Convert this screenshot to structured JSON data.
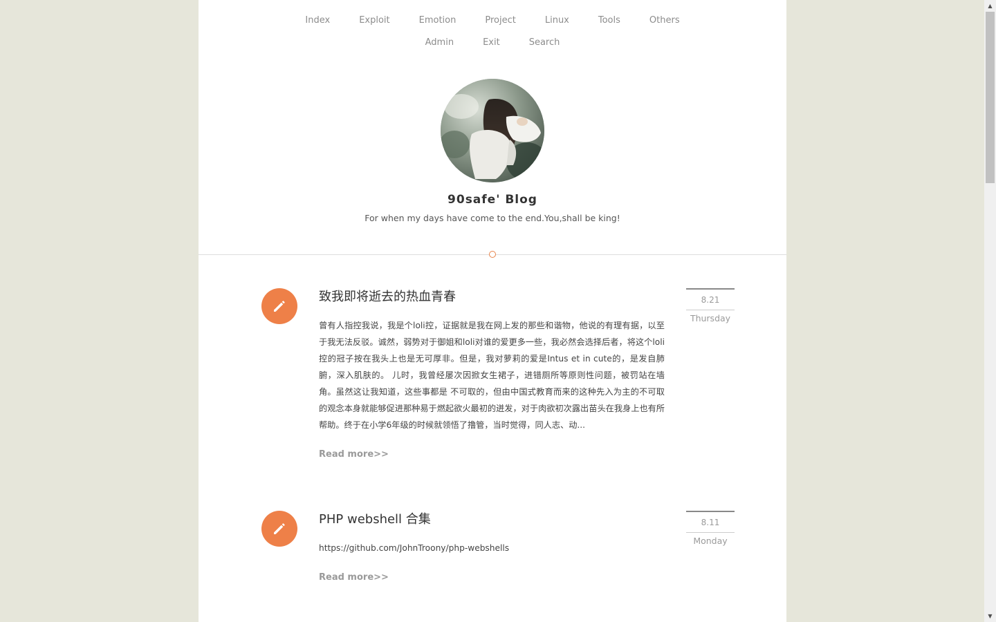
{
  "nav": {
    "row1": [
      "Index",
      "Exploit",
      "Emotion",
      "Project",
      "Linux",
      "Tools",
      "Others"
    ],
    "row2": [
      "Admin",
      "Exit",
      "Search"
    ]
  },
  "header": {
    "title": "90safe' Blog",
    "subtitle": "For when my days have come to the end.You,shall be king!"
  },
  "posts": [
    {
      "title": "致我即将逝去的热血青春",
      "excerpt": "曾有人指控我说，我是个loli控，证据就是我在网上发的那些和谐物，他说的有理有据，以至于我无法反驳。诚然，弱势对于御姐和loli对谁的爱更多一些，我必然会选择后者，将这个loli控的冠子按在我头上也是无可厚非。但是，我对萝莉的爱是Intus et in cute的，是发自肺腑，深入肌肤的。 儿时，我曾经屡次因掀女生裙子，进错厕所等原则性问题，被罚站在墙角。虽然这让我知道，这些事都是 不可取的，但由中国式教育而来的这种先入为主的不可取的观念本身就能够促进那种易于燃起欲火最初的迸发，对于肉欲初次露出苗头在我身上也有所帮助。终于在小学6年级的时候就领悟了撸管，当时觉得，同人志、动...",
      "read_more": "Read more>>",
      "date": "8.21",
      "weekday": "Thursday"
    },
    {
      "title": "PHP webshell 合集",
      "excerpt": "https://github.com/JohnTroony/php-webshells",
      "read_more": "Read more>>",
      "date": "8.11",
      "weekday": "Monday"
    }
  ],
  "colors": {
    "background": "#e6e6da",
    "accent": "#ee8048"
  },
  "icons": {
    "post": "pencil-icon"
  }
}
